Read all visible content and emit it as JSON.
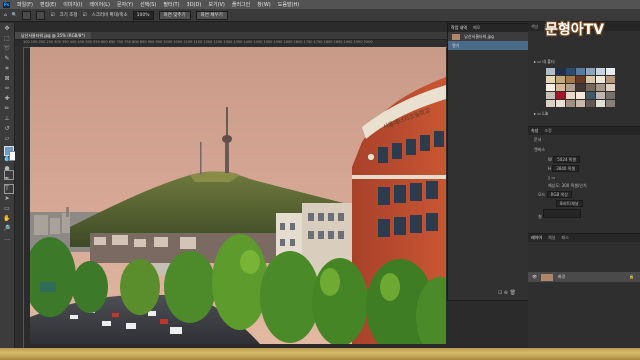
{
  "menu": {
    "app_logo": "Ps",
    "items": [
      "파일(F)",
      "편집(E)",
      "이미지(I)",
      "레이어(L)",
      "문자(Y)",
      "선택(S)",
      "필터(T)",
      "3D(D)",
      "보기(V)",
      "플러그인",
      "창(W)",
      "도움말(H)"
    ]
  },
  "options": {
    "size_label": "크기 조정",
    "zoom_value": "100%",
    "fit_screen_btn": "화면 맞추기",
    "fill_screen_btn": "화면 채우기",
    "scrubby_label": "스크러비 확대/축소"
  },
  "document": {
    "tab_title": "남산서울타워.jpg @ 25% (RGB/8*)",
    "ruler_ticks": "100 150 200 250 300 350 400 450 500 550 600 650 700 750 800 850 900 950 1000 1050 1100 1150 1200 1250 1300 1350 1400 1450 1500 1550 1600 1650 1700 1750 1800 1850 1900 1950 2000"
  },
  "float_panel": {
    "tabs": [
      "작업 내역",
      "메모"
    ],
    "rows": [
      "남산서울타워.jpg",
      "열기"
    ]
  },
  "right_panel": {
    "swatch_tabs": [
      "색상",
      "견본",
      "그레이디언트",
      "패턴"
    ],
    "folder_label": "내 폴더",
    "lib_label": "Lib",
    "props_tabs": [
      "속성",
      "조정"
    ],
    "props_title": "문서",
    "canvas_label": "캔버스",
    "w_value": "5024 픽셀",
    "h_value": "3840 픽셀",
    "resolution": "해상도: 300 픽셀/인치",
    "mode_label": "모드",
    "mode_value": "RGB 색상",
    "depth_value": "8비트/채널",
    "fill_label": "칠",
    "layers_tabs": [
      "레이어",
      "채널",
      "패스"
    ],
    "layer_name": "배경"
  },
  "watermark": "문형아TV",
  "colors": {
    "accent": "#31a8ff",
    "foreground": "#6a9ec8",
    "background": "#ffffff"
  }
}
